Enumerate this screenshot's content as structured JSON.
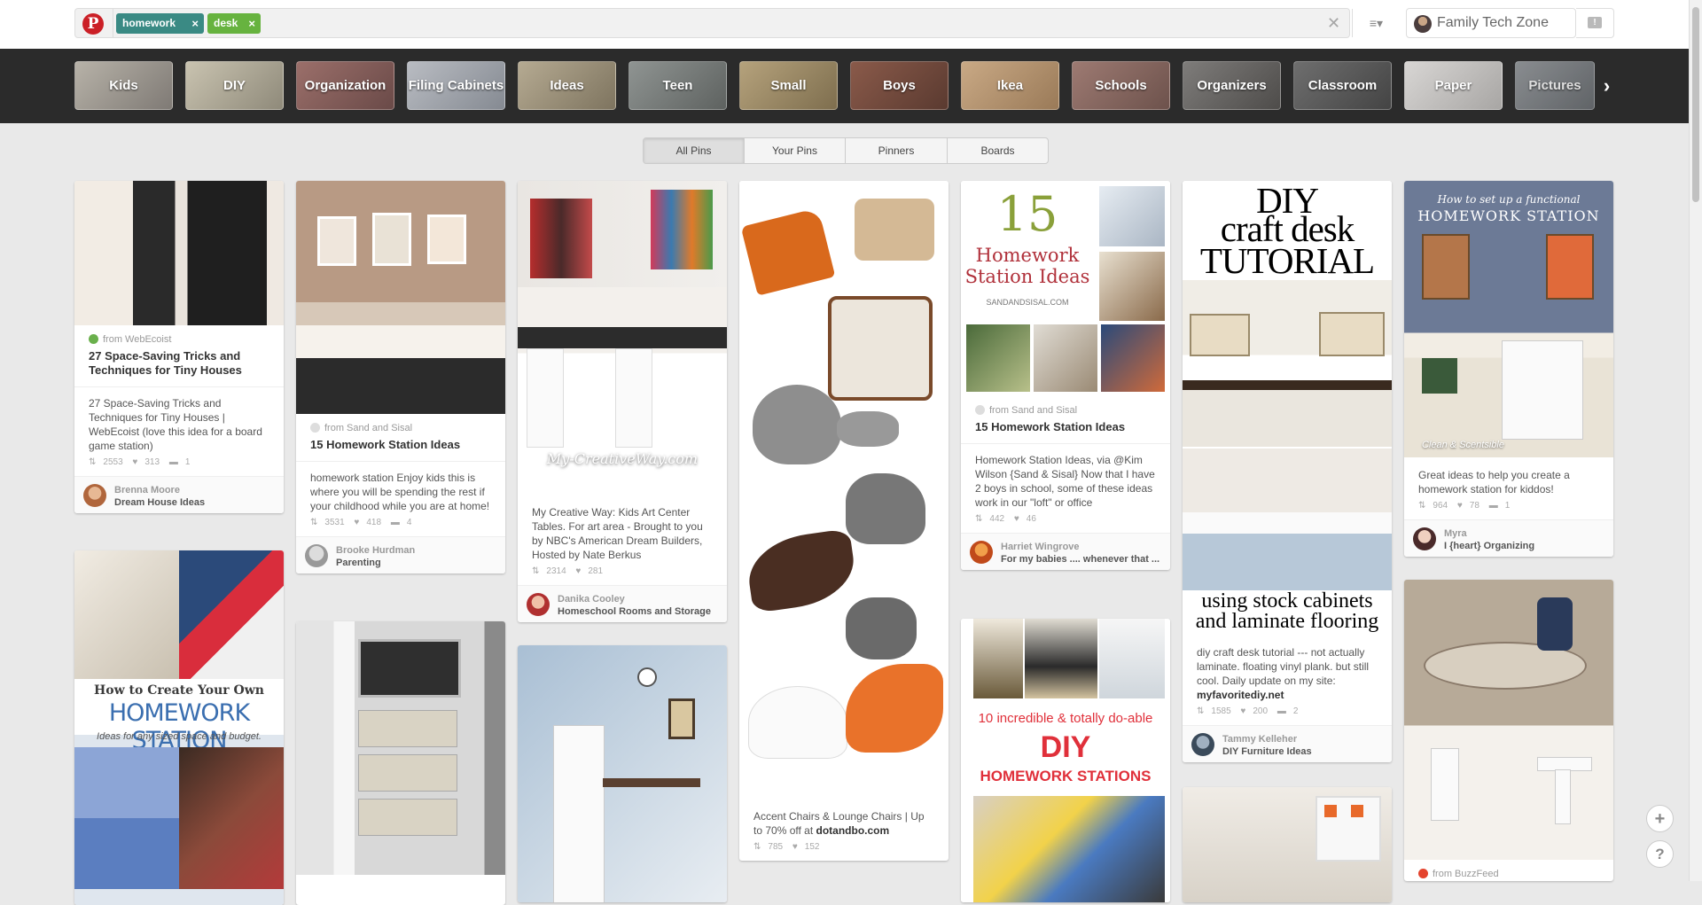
{
  "header": {
    "search_tokens": [
      "homework",
      "desk"
    ],
    "clear_symbol": "✕",
    "menu_symbol": "≡▾",
    "profile_name": "Family Tech Zone",
    "notif_symbol": "!"
  },
  "categories": [
    "Kids",
    "DIY",
    "Organization",
    "Filing Cabinets",
    "Ideas",
    "Teen",
    "Small",
    "Boys",
    "Ikea",
    "Schools",
    "Organizers",
    "Classroom",
    "Paper",
    "Pictures"
  ],
  "category_next": "›",
  "tabs": [
    "All Pins",
    "Your Pins",
    "Pinners",
    "Boards"
  ],
  "pins": {
    "p1": {
      "source": "from WebEcoist",
      "title": "27 Space-Saving Tricks and Techniques for Tiny Houses",
      "desc": "27 Space-Saving Tricks and Techniques for Tiny Houses | WebEcoist (love this idea for a board game station)",
      "repins": "2553",
      "likes": "313",
      "comments": "1",
      "pinner": "Brenna Moore",
      "board": "Dream House Ideas"
    },
    "p2": {
      "overlay_1": "How to Create Your Own",
      "overlay_2": "HOMEWORK STATION",
      "overlay_3": "Ideas for any sized space and budget."
    },
    "p3": {
      "source": "from Sand and Sisal",
      "title": "15 Homework Station Ideas",
      "desc": "homework station Enjoy kids this is where you will be spending the rest if your childhood while you are at home!",
      "repins": "3531",
      "likes": "418",
      "comments": "4",
      "pinner": "Brooke Hurdman",
      "board": "Parenting"
    },
    "p5": {
      "watermark": "My-CreativeWay.com",
      "desc": "My Creative Way: Kids Art Center Tables. For art area - Brought to you by NBC's American Dream Builders, Hosted by Nate Berkus",
      "repins": "2314",
      "likes": "281",
      "pinner": "Danika Cooley",
      "board": "Homeschool Rooms and Storage"
    },
    "p7": {
      "desc_text": "Accent Chairs & Lounge Chairs | Up to 70% off at ",
      "desc_link": "dotandbo.com",
      "repins": "785",
      "likes": "152"
    },
    "p8": {
      "overlay_num": "15",
      "overlay_1": "Homework",
      "overlay_2": "Station Ideas",
      "overlay_3": "SANDANDSISAL.COM",
      "source": "from Sand and Sisal",
      "title": "15 Homework Station Ideas",
      "desc": "Homework Station Ideas, via @Kim Wilson {Sand & Sisal} Now that I have 2 boys in school, some of these ideas work in our \"loft\" or office",
      "repins": "442",
      "likes": "46",
      "pinner": "Harriet Wingrove",
      "board": "For my babies .... whenever that ..."
    },
    "p9": {
      "overlay_1": "10 incredible & totally do-able",
      "overlay_2": "DIY",
      "overlay_3": "HOMEWORK STATIONS"
    },
    "p10": {
      "overlay_1": "DIY",
      "overlay_2": "craft desk",
      "overlay_3": "TUTORIAL",
      "overlay_4": "using stock cabinets",
      "overlay_5": "and laminate flooring",
      "desc_text": "diy craft desk tutorial --- not actually laminate. floating vinyl plank. but still cool. Daily update on my site: ",
      "desc_link": "myfavoritediy.net",
      "repins": "1585",
      "likes": "200",
      "comments": "2",
      "pinner": "Tammy Kelleher",
      "board": "DIY Furniture Ideas"
    },
    "p12": {
      "overlay_1": "How to set up a functional",
      "overlay_2": "HOMEWORK STATION",
      "overlay_3": "Clean & Scentsible",
      "desc": "Great ideas to help you create a homework station for kiddos!",
      "repins": "964",
      "likes": "78",
      "comments": "1",
      "pinner": "Myra",
      "board": "I {heart} Organizing"
    },
    "p13": {
      "source": "from BuzzFeed"
    }
  },
  "fab": {
    "add": "+",
    "help": "?"
  },
  "colors": {
    "pinterest_red": "#cb2027",
    "token_homework": "#3a8a84",
    "token_desk": "#67b33f",
    "category_bar": "#2b2b2b"
  }
}
